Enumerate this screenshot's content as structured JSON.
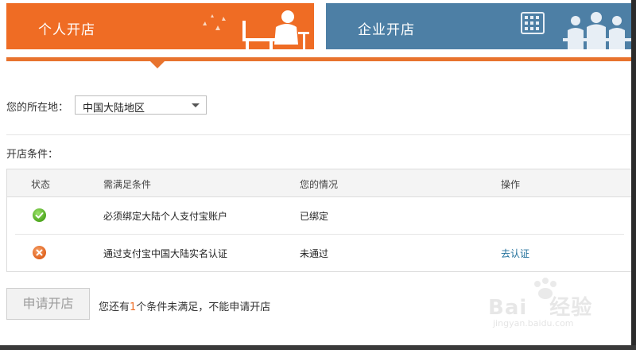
{
  "tabs": {
    "personal": "个人开店",
    "enterprise": "企业开店"
  },
  "location": {
    "label": "您的所在地：",
    "selected": "中国大陆地区"
  },
  "conditions": {
    "label": "开店条件：",
    "headers": [
      "状态",
      "需满足条件",
      "您的情况",
      "操作"
    ],
    "rows": [
      {
        "status": "ok-icon",
        "requirement": "必须绑定大陆个人支付宝账户",
        "situation": "已绑定",
        "action": ""
      },
      {
        "status": "fail-icon",
        "requirement": "通过支付宝中国大陆实名认证",
        "situation": "未通过",
        "action": "去认证"
      }
    ]
  },
  "apply": {
    "button": "申请开店",
    "hint_prefix": "您还有",
    "hint_count": "1",
    "hint_suffix": "个条件未满足，不能申请开店"
  },
  "watermark": {
    "brand": "Bai",
    "brand_cn": "经验",
    "site": "jingyan.baidu.com"
  },
  "colors": {
    "personal_tab": "#ef6c24",
    "enterprise_tab": "#4d7fa5",
    "link": "#1f6f9a"
  }
}
